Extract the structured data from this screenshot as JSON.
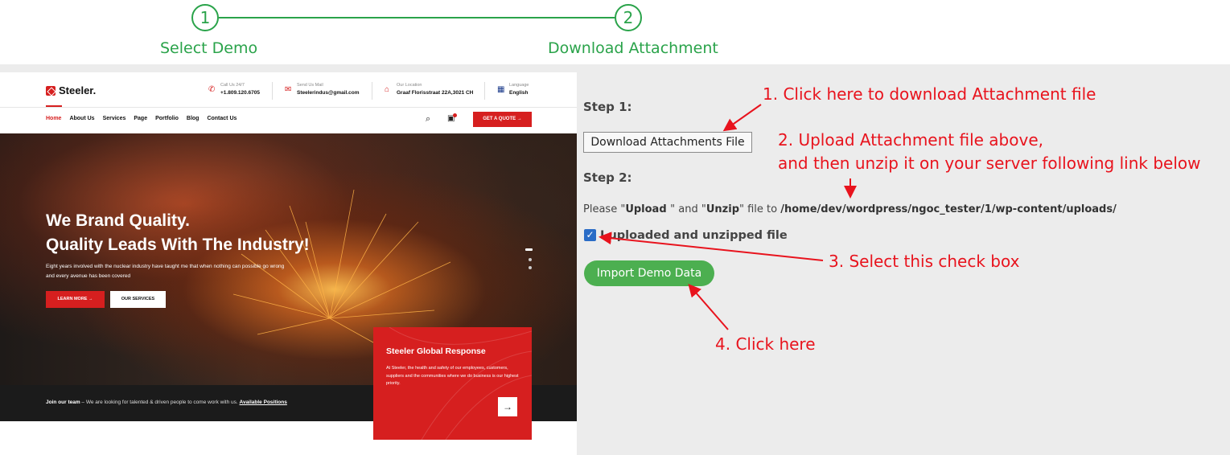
{
  "stepper": {
    "steps": [
      {
        "number": "1",
        "label": "Select Demo"
      },
      {
        "number": "2",
        "label": "Download Attachment"
      }
    ]
  },
  "preview": {
    "logo": "Steeler.",
    "contacts": [
      {
        "label": "Call Us 24/7",
        "value": "+1.809.120.6705",
        "icon": "phone-icon"
      },
      {
        "label": "Send Us Mail",
        "value": "Steelerindus@gmail.com",
        "icon": "mail-icon"
      },
      {
        "label": "Our Location",
        "value": "Graaf Florisstraat 22A,3021 CH",
        "icon": "location-icon"
      },
      {
        "label": "Language",
        "value": "English",
        "icon": "flag-icon"
      }
    ],
    "nav": [
      "Home",
      "About Us",
      "Services",
      "Page",
      "Portfolio",
      "Blog",
      "Contact Us"
    ],
    "quote_button": "GET A QUOTE →",
    "hero": {
      "title_line1": "We Brand Quality.",
      "title_line2": "Quality Leads With The Industry!",
      "desc_line1": "Eight years involved with the nuclear industry have taught me that when nothing can possible go wrong",
      "desc_line2": "and every avenue has been covered",
      "learn_more": "LEARN MORE →",
      "our_services": "OUR SERVICES"
    },
    "bottom": {
      "lead": "Join our team",
      "text": " – We are looking for talented & driven people to come work with us. ",
      "link": "Available Positions"
    },
    "card": {
      "title": "Steeler Global Response",
      "text": "At Steeler, the health and safety of our employees, customers, suppliers and the communities where we do business is our highest priority.",
      "arrow": "→"
    }
  },
  "panel": {
    "step1": "Step 1:",
    "download_button": "Download Attachments File",
    "step2": "Step 2:",
    "upload_prefix": "Please \"",
    "upload_word": "Upload ",
    "upload_mid": "\" and \"",
    "unzip_word": "Unzip",
    "upload_suffix": "\" file to ",
    "path": "/home/dev/wordpress/ngoc_tester/1/wp-content/uploads/",
    "checkbox_label": "I uploaded and unzipped file",
    "import_button": "Import Demo Data"
  },
  "annotations": {
    "a1": "1. Click here to download Attachment file",
    "a2_line1": "2. Upload Attachment file above,",
    "a2_line2": "and then unzip it on your server following link below",
    "a3": "3. Select this check box",
    "a4": "4. Click here"
  },
  "colors": {
    "accent_green": "#2aa34a",
    "brand_red": "#d61f1f",
    "annotation_red": "#e8131d",
    "import_green": "#4caf50"
  }
}
